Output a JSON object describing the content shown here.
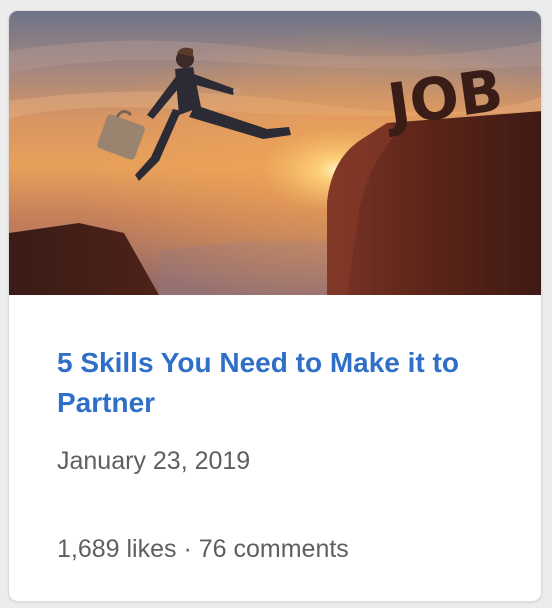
{
  "post": {
    "image_text": "JOB",
    "title": "5 Skills You Need to Make it to Partner",
    "date": "January 23, 2019",
    "likes": "1,689 likes",
    "separator": " · ",
    "comments": "76 comments"
  },
  "colors": {
    "title": "#2f6fc7",
    "meta": "#5f5f5f",
    "card_bg": "#ffffff",
    "page_bg": "#ececec"
  }
}
